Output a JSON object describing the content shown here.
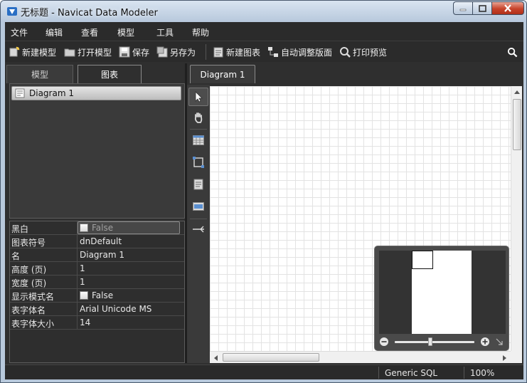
{
  "window": {
    "title": "无标题 - Navicat Data Modeler",
    "icons": {
      "app": "navicat-app-icon",
      "minimize": "minimize-icon",
      "maximize": "maximize-icon",
      "close": "close-icon"
    }
  },
  "menu": [
    "文件",
    "编辑",
    "查看",
    "模型",
    "工具",
    "帮助"
  ],
  "toolbar": {
    "new_model": "新建模型",
    "open_model": "打开模型",
    "save": "保存",
    "save_as": "另存为",
    "new_diagram": "新建图表",
    "auto_layout": "自动调整版面",
    "print_preview": "打印预览"
  },
  "left_tabs": [
    "模型",
    "图表"
  ],
  "active_left_tab": "图表",
  "tree": {
    "items": [
      "Diagram 1"
    ]
  },
  "properties": [
    {
      "key": "黑白",
      "value": "False",
      "checkbox": true
    },
    {
      "key": "图表符号",
      "value": "dnDefault"
    },
    {
      "key": "名",
      "value": "Diagram 1"
    },
    {
      "key": "高度 (页)",
      "value": "1"
    },
    {
      "key": "宽度 (页)",
      "value": "1"
    },
    {
      "key": "显示模式名",
      "value": "False",
      "checkbox": true
    },
    {
      "key": "表字体名",
      "value": "Arial Unicode MS"
    },
    {
      "key": "表字体大小",
      "value": "14"
    }
  ],
  "doc_tab": "Diagram 1",
  "palette_tools": [
    "pointer-icon",
    "hand-icon",
    "table-icon",
    "view-icon",
    "note-icon",
    "label-icon",
    "relation-icon"
  ],
  "overview": {
    "zoom_fraction": 0.45
  },
  "status": {
    "database": "Generic SQL",
    "zoom": "100%"
  },
  "colors": {
    "panel_dark": "#2f2f2f",
    "accent_close": "#c7432a"
  }
}
